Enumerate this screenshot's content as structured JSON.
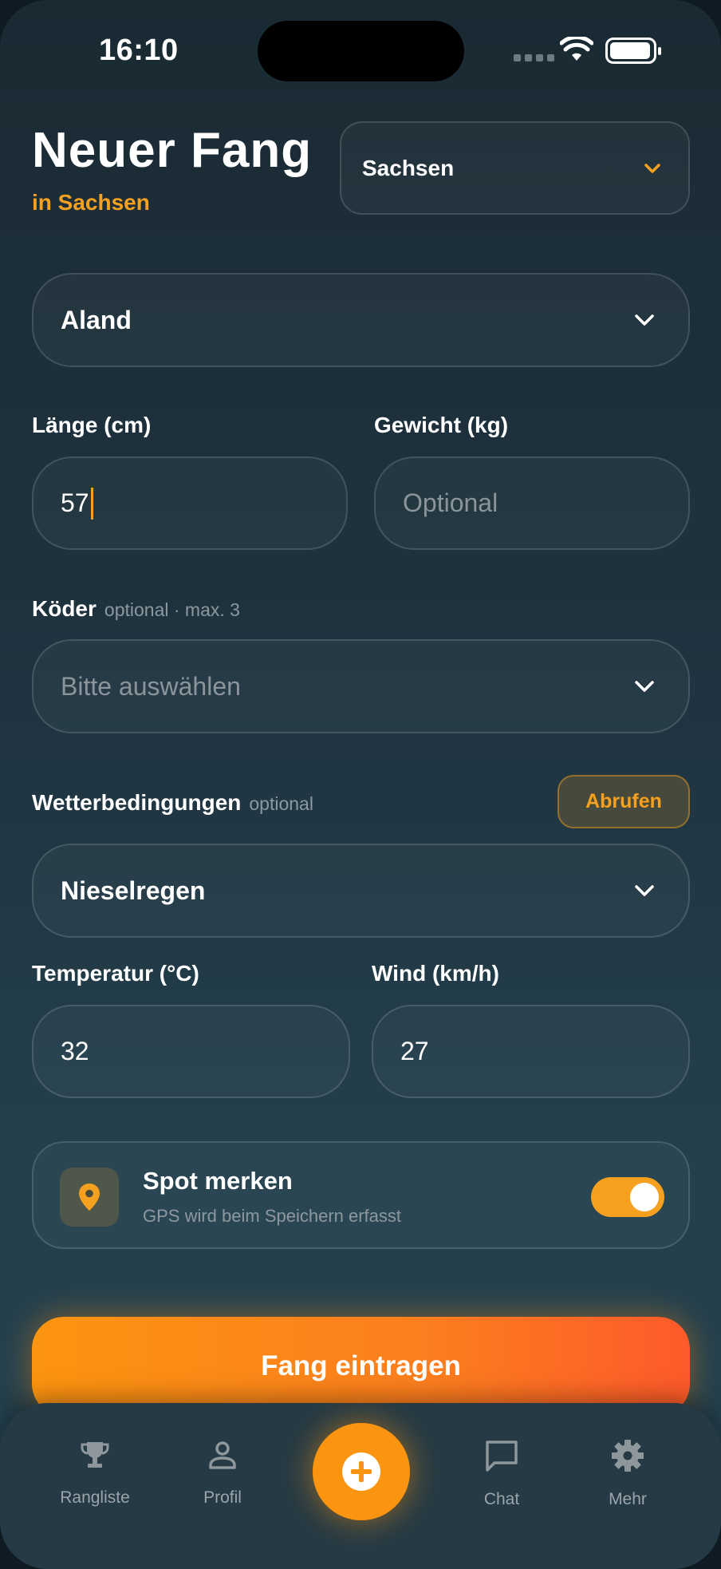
{
  "status_bar": {
    "time": "16:10"
  },
  "header": {
    "title": "Neuer Fang",
    "subtitle": "in Sachsen"
  },
  "state_select": {
    "value": "Sachsen"
  },
  "species_select": {
    "value": "Aland"
  },
  "length": {
    "label": "Länge (cm)",
    "value": "57"
  },
  "weight": {
    "label": "Gewicht (kg)",
    "placeholder": "Optional"
  },
  "bait": {
    "label": "Köder",
    "hint": "optional · max. 3",
    "placeholder": "Bitte auswählen"
  },
  "weather": {
    "label": "Wetterbedingungen",
    "hint": "optional",
    "fetch_label": "Abrufen",
    "value": "Nieselregen"
  },
  "temperature": {
    "label": "Temperatur (°C)",
    "value": "32"
  },
  "wind": {
    "label": "Wind (km/h)",
    "value": "27"
  },
  "spot": {
    "title": "Spot merken",
    "subtitle": "GPS wird beim Speichern erfasst",
    "enabled": true
  },
  "submit_label": "Fang eintragen",
  "tabs": [
    {
      "label": "Rangliste",
      "icon": "trophy-icon"
    },
    {
      "label": "Profil",
      "icon": "person-icon"
    },
    {
      "label": "",
      "icon": "add-icon"
    },
    {
      "label": "Chat",
      "icon": "chat-icon"
    },
    {
      "label": "Mehr",
      "icon": "gear-icon"
    }
  ],
  "colors": {
    "accent": "#f6a01f",
    "button_gradient_start": "#fb9410",
    "button_gradient_end": "#fd5a2a",
    "background": "#1f3440"
  }
}
